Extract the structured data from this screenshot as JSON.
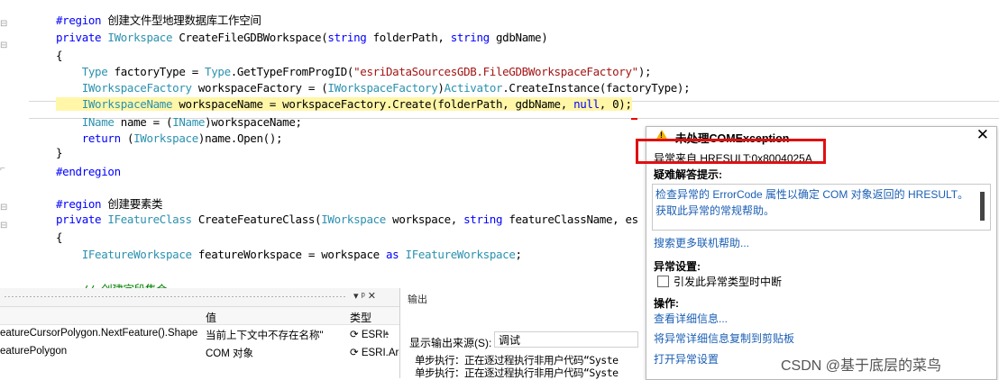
{
  "code": {
    "lines": [
      [
        {
          "t": "#region ",
          "c": "kw"
        },
        {
          "t": "创建文件型地理数据库工作空间",
          "c": ""
        }
      ],
      [
        {
          "t": "private ",
          "c": "kw"
        },
        {
          "t": "IWorkspace",
          "c": "ty"
        },
        {
          "t": " CreateFileGDBWorkspace(",
          "c": ""
        },
        {
          "t": "string",
          "c": "kw"
        },
        {
          "t": " folderPath, ",
          "c": ""
        },
        {
          "t": "string",
          "c": "kw"
        },
        {
          "t": " gdbName)",
          "c": ""
        }
      ],
      [
        {
          "t": "{",
          "c": ""
        }
      ],
      [
        {
          "t": "    Type",
          "c": "ty"
        },
        {
          "t": " factoryType = ",
          "c": ""
        },
        {
          "t": "Type",
          "c": "ty"
        },
        {
          "t": ".GetTypeFromProgID(",
          "c": ""
        },
        {
          "t": "\"esriDataSourcesGDB.FileGDBWorkspaceFactory\"",
          "c": "st"
        },
        {
          "t": ");",
          "c": ""
        }
      ],
      [
        {
          "t": "    IWorkspaceFactory",
          "c": "ty"
        },
        {
          "t": " workspaceFactory = (",
          "c": ""
        },
        {
          "t": "IWorkspaceFactory",
          "c": "ty"
        },
        {
          "t": ")",
          "c": ""
        },
        {
          "t": "Activator",
          "c": "ty"
        },
        {
          "t": ".CreateInstance(factoryType);",
          "c": ""
        }
      ],
      [
        {
          "t": "    IWorkspaceName",
          "c": "ty hl"
        },
        {
          "t": " workspaceName = workspaceFactory.Create(folderPath, gdbName, ",
          "c": "hl"
        },
        {
          "t": "null",
          "c": "kw hl"
        },
        {
          "t": ", 0);",
          "c": "hl"
        }
      ],
      [
        {
          "t": "    IName",
          "c": "ty"
        },
        {
          "t": " name = (",
          "c": ""
        },
        {
          "t": "IName",
          "c": "ty"
        },
        {
          "t": ")workspaceName;",
          "c": ""
        }
      ],
      [
        {
          "t": "    return",
          "c": "kw"
        },
        {
          "t": " (",
          "c": ""
        },
        {
          "t": "IWorkspace",
          "c": "ty"
        },
        {
          "t": ")name.Open();",
          "c": ""
        }
      ],
      [
        {
          "t": "}",
          "c": ""
        }
      ],
      [
        {
          "t": "#endregion",
          "c": "kw"
        }
      ],
      [
        {
          "t": "",
          "c": ""
        }
      ],
      [
        {
          "t": "#region ",
          "c": "kw"
        },
        {
          "t": "创建要素类",
          "c": ""
        }
      ],
      [
        {
          "t": "private ",
          "c": "kw"
        },
        {
          "t": "IFeatureClass",
          "c": "ty"
        },
        {
          "t": " CreateFeatureClass(",
          "c": ""
        },
        {
          "t": "IWorkspace",
          "c": "ty"
        },
        {
          "t": " workspace, ",
          "c": ""
        },
        {
          "t": "string",
          "c": "kw"
        },
        {
          "t": " featureClassName, es",
          "c": ""
        }
      ],
      [
        {
          "t": "{",
          "c": ""
        }
      ],
      [
        {
          "t": "    IFeatureWorkspace",
          "c": "ty"
        },
        {
          "t": " featureWorkspace = workspace ",
          "c": ""
        },
        {
          "t": "as",
          "c": "kw"
        },
        {
          "t": " ",
          "c": ""
        },
        {
          "t": "IFeatureWorkspace",
          "c": "ty"
        },
        {
          "t": ";",
          "c": ""
        }
      ],
      [
        {
          "t": "",
          "c": ""
        }
      ],
      [
        {
          "t": "    // 创建字段集合",
          "c": "cm"
        }
      ]
    ]
  },
  "locals": {
    "col_value": "值",
    "col_type": "类型",
    "pin_label": "▾ ᵖ ✕",
    "rows": [
      {
        "name": "eatureCursorPolygon.NextFeature().Shape",
        "value": "当前上下文中不存在名称\"",
        "type": "ESRI."
      },
      {
        "name": "eaturePolygon",
        "value": "COM 对象",
        "type": "ESRI.Ar"
      }
    ]
  },
  "output": {
    "title": "输出",
    "source_label": "显示输出来源(S):",
    "source_value": "调试",
    "lines": [
      "单步执行：正在逐过程执行非用户代码“Syste",
      "单步执行：正在逐过程执行非用户代码“Syste"
    ]
  },
  "exception": {
    "title": "未处理COMException",
    "hresult": "异常来自 HRESULT:0x8004025A",
    "tips_header": "疑难解答提示:",
    "tip1": "检查异常的 ErrorCode 属性以确定 COM 对象返回的 HRESULT。",
    "tip2": "获取此异常的常规帮助。",
    "search_more": "搜索更多联机帮助...",
    "settings_header": "异常设置:",
    "break_checkbox": "引发此异常类型时中断",
    "actions_header": "操作:",
    "view_detail": "查看详细信息...",
    "copy_detail": "将异常详细信息复制到剪贴板",
    "open_settings": "打开异常设置"
  },
  "watermark": "CSDN @基于底层的菜鸟",
  "colors": {
    "keyword": "#0000ff",
    "type": "#2b91af",
    "string": "#a31515",
    "highlight": "#fff6a8",
    "link": "#1a5fb4",
    "error_box": "#e01010"
  }
}
